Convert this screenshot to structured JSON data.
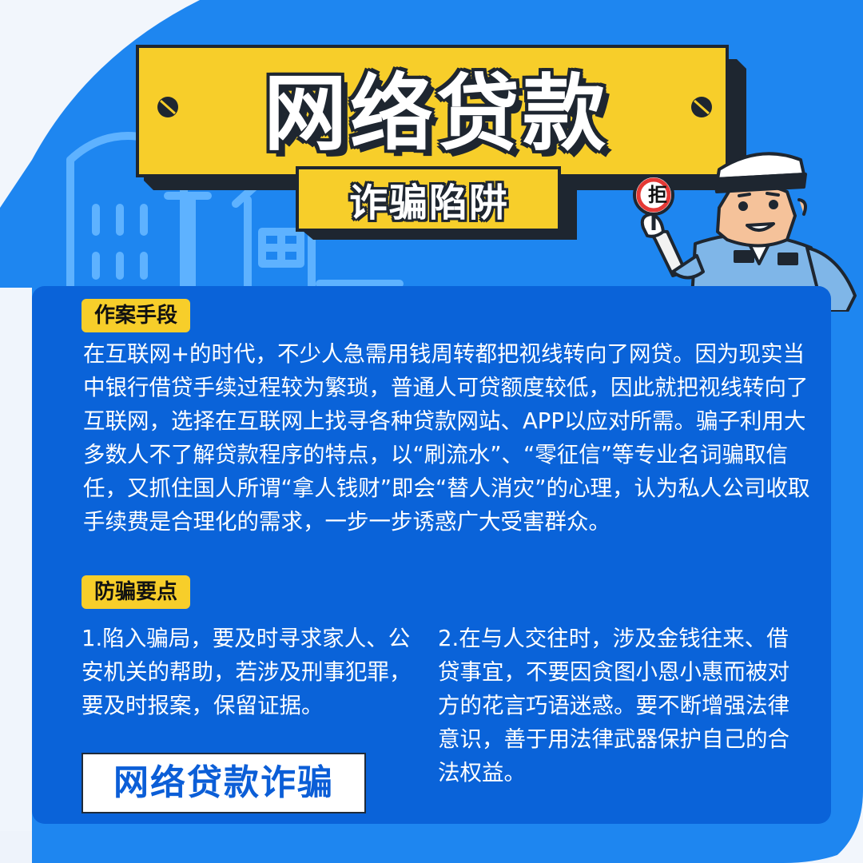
{
  "header": {
    "title": "网络贷款",
    "subtitle": "诈骗陷阱",
    "sign_text": "拒"
  },
  "sections": {
    "method": {
      "tag": "作案手段",
      "text": "在互联网+的时代，不少人急需用钱周转都把视线转向了网贷。因为现实当中银行借贷手续过程较为繁琐，普通人可贷额度较低，因此就把视线转向了互联网，选择在互联网上找寻各种贷款网站、APP以应对所需。骗子利用大多数人不了解贷款程序的特点，以“刷流水”、“零征信”等专业名词骗取信任，又抓住国人所谓“拿人钱财”即会“替人消灾”的心理，认为私人公司收取手续费是合理化的需求，一步一步诱惑广大受害群众。"
    },
    "prevention": {
      "tag": "防骗要点",
      "left": "1.陷入骗局，要及时寻求家人、公安机关的帮助，若涉及刑事犯罪，要及时报案，保留证据。",
      "right": "2.在与人交往时，涉及金钱往来、借贷事宜，不要因贪图小恩小惠而被对方的花言巧语迷惑。要不断增强法律意识，善于用法律武器保护自己的合法权益。"
    }
  },
  "footer_stamp": "网络贷款诈骗",
  "colors": {
    "background_blue": "#1e86f0",
    "panel_blue": "#0a63d9",
    "banner_yellow": "#f7ce2a",
    "outline": "#1e2630"
  }
}
